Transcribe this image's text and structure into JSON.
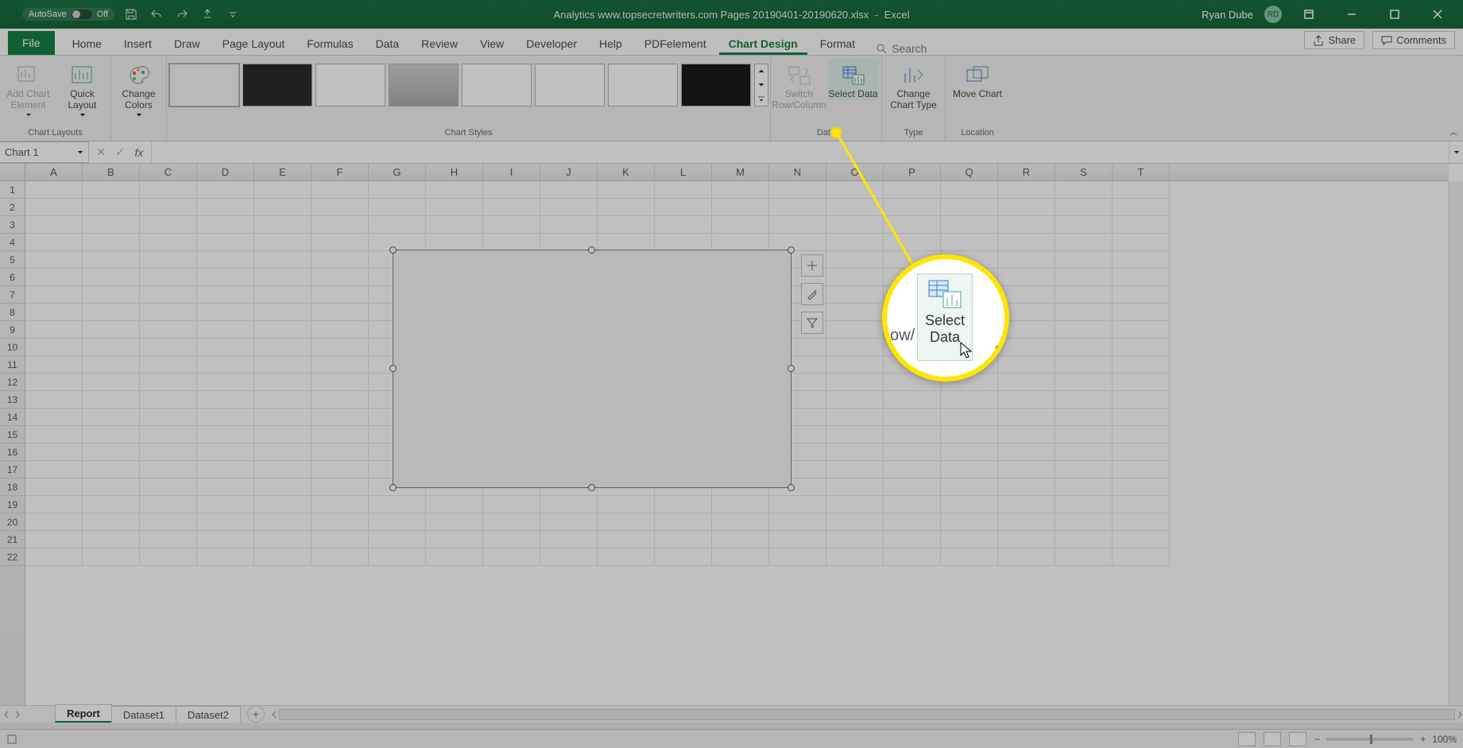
{
  "titlebar": {
    "autosave_label": "AutoSave",
    "autosave_state": "Off",
    "doc_title": "Analytics www.topsecretwriters.com Pages 20190401-20190620.xlsx",
    "app_name": "Excel",
    "user_name": "Ryan Dube",
    "user_initials": "RD"
  },
  "ribbon": {
    "file": "File",
    "tabs": [
      "Home",
      "Insert",
      "Draw",
      "Page Layout",
      "Formulas",
      "Data",
      "Review",
      "View",
      "Developer",
      "Help",
      "PDFelement",
      "Chart Design",
      "Format"
    ],
    "active_tab": "Chart Design",
    "search_placeholder": "Search",
    "share": "Share",
    "comments": "Comments"
  },
  "chart_design": {
    "group_chart_layouts": "Chart Layouts",
    "add_chart_element": "Add Chart Element",
    "quick_layout": "Quick Layout",
    "change_colors": "Change Colors",
    "group_chart_styles": "Chart Styles",
    "group_data": "Data",
    "switch_row_col": "Switch Row/Column",
    "select_data": "Select Data",
    "group_type": "Type",
    "change_chart_type": "Change Chart Type",
    "group_location": "Location",
    "move_chart": "Move Chart"
  },
  "formula_bar": {
    "name_box": "Chart 1",
    "fx_label": "fx"
  },
  "grid": {
    "columns": [
      "A",
      "B",
      "C",
      "D",
      "E",
      "F",
      "G",
      "H",
      "I",
      "J",
      "K",
      "L",
      "M",
      "N",
      "O",
      "P",
      "Q",
      "R",
      "S",
      "T"
    ],
    "row_count": 22
  },
  "sheets": {
    "tabs": [
      "Report",
      "Dataset1",
      "Dataset2"
    ],
    "active": "Report"
  },
  "statusbar": {
    "zoom": "100%"
  },
  "callout": {
    "label_top": "Select",
    "label_bottom": "Data",
    "side_left": "ow/",
    "side_right": "C"
  }
}
